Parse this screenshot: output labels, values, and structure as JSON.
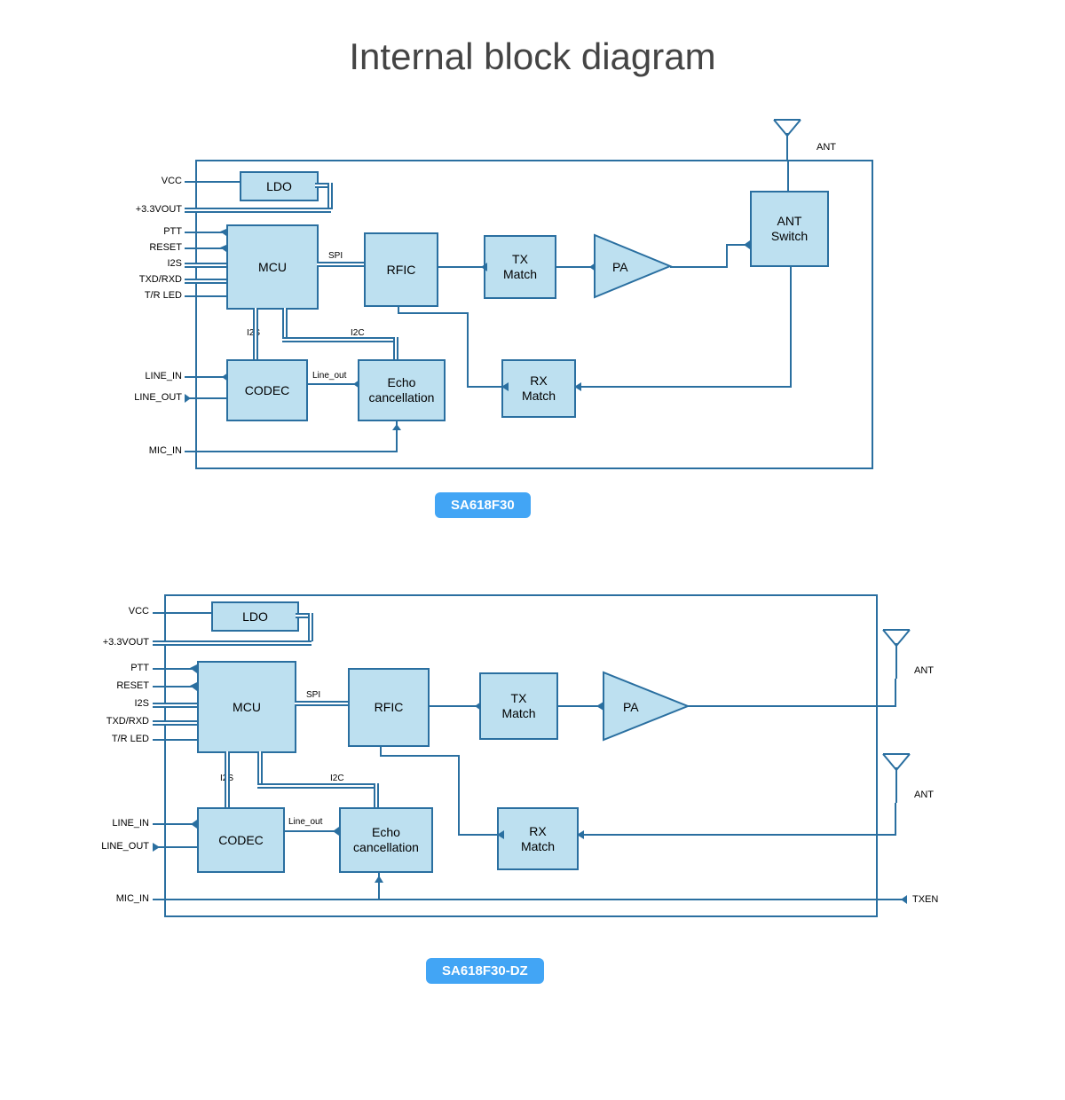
{
  "title": "Internal block diagram",
  "diagram1": {
    "name": "SA618F30",
    "blocks": {
      "ldo": "LDO",
      "mcu": "MCU",
      "rfic": "RFIC",
      "txmatch": "TX\nMatch",
      "pa": "PA",
      "antswitch": "ANT\nSwitch",
      "codec": "CODEC",
      "echo": "Echo\ncancellation",
      "rxmatch": "RX\nMatch"
    },
    "pins": {
      "vcc": "VCC",
      "v33": "+3.3VOUT",
      "ptt": "PTT",
      "reset": "RESET",
      "i2s": "I2S",
      "txdrxd": "TXD/RXD",
      "trled": "T/R LED",
      "linein": "LINE_IN",
      "lineout": "LINE_OUT",
      "micin": "MIC_IN",
      "ant": "ANT"
    },
    "labels": {
      "spi": "SPI",
      "i2s": "I2S",
      "i2c": "I2C",
      "lineout": "Line_out"
    }
  },
  "diagram2": {
    "name": "SA618F30-DZ",
    "blocks": {
      "ldo": "LDO",
      "mcu": "MCU",
      "rfic": "RFIC",
      "txmatch": "TX\nMatch",
      "pa": "PA",
      "codec": "CODEC",
      "echo": "Echo\ncancellation",
      "rxmatch": "RX\nMatch"
    },
    "pins": {
      "vcc": "VCC",
      "v33": "+3.3VOUT",
      "ptt": "PTT",
      "reset": "RESET",
      "i2s": "I2S",
      "txdrxd": "TXD/RXD",
      "trled": "T/R LED",
      "linein": "LINE_IN",
      "lineout": "LINE_OUT",
      "micin": "MIC_IN",
      "ant": "ANT",
      "txen": "TXEN"
    },
    "labels": {
      "spi": "SPI",
      "i2s": "I2S",
      "i2c": "I2C",
      "lineout": "Line_out"
    }
  }
}
